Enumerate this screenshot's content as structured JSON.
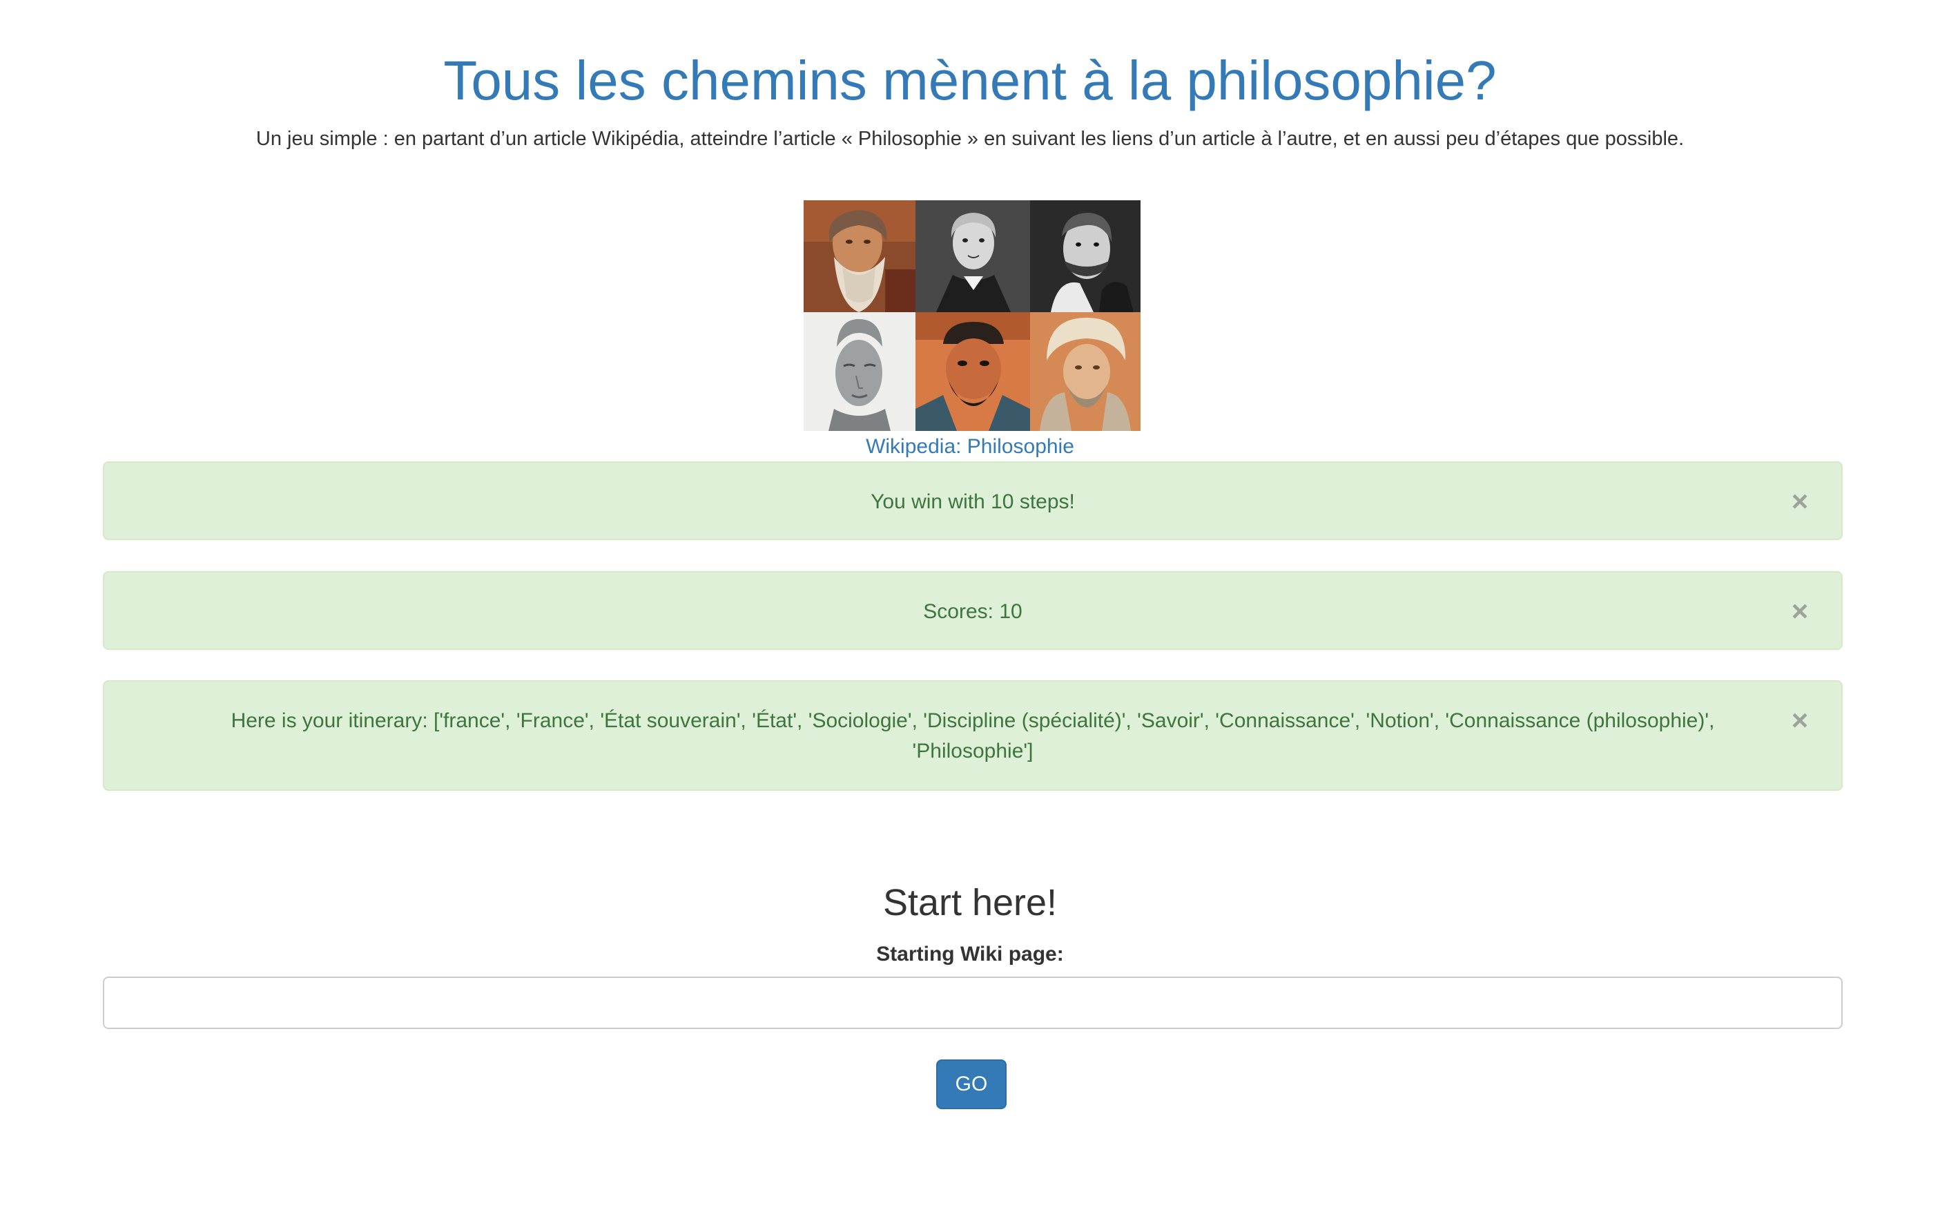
{
  "header": {
    "title": "Tous les chemins mènent à la philosophie?",
    "subtitle": "Un jeu simple : en partant d’un article Wikipédia, atteindre l’article « Philosophie » en suivant les liens d’un article à l’autre, et en aussi peu d’étapes que possible."
  },
  "image": {
    "icon": "philosophers-portrait-mosaic",
    "link_label": "Wikipedia: Philosophie"
  },
  "alerts": [
    {
      "text": "You win with 10 steps!",
      "close_label": "×"
    },
    {
      "text": "Scores: 10",
      "close_label": "×"
    },
    {
      "text": "Here is your itinerary: ['france', 'France', 'État souverain', 'État', 'Sociologie', 'Discipline (spécialité)', 'Savoir', 'Connaissance', 'Notion', 'Connaissance (philosophie)', 'Philosophie']",
      "close_label": "×"
    }
  ],
  "form": {
    "heading": "Start here!",
    "label": "Starting Wiki page:",
    "input_value": "",
    "input_placeholder": "",
    "submit_label": "GO"
  },
  "colors": {
    "accent": "#337ab7",
    "alert_background": "#dff0d8",
    "alert_text": "#3c763d"
  }
}
